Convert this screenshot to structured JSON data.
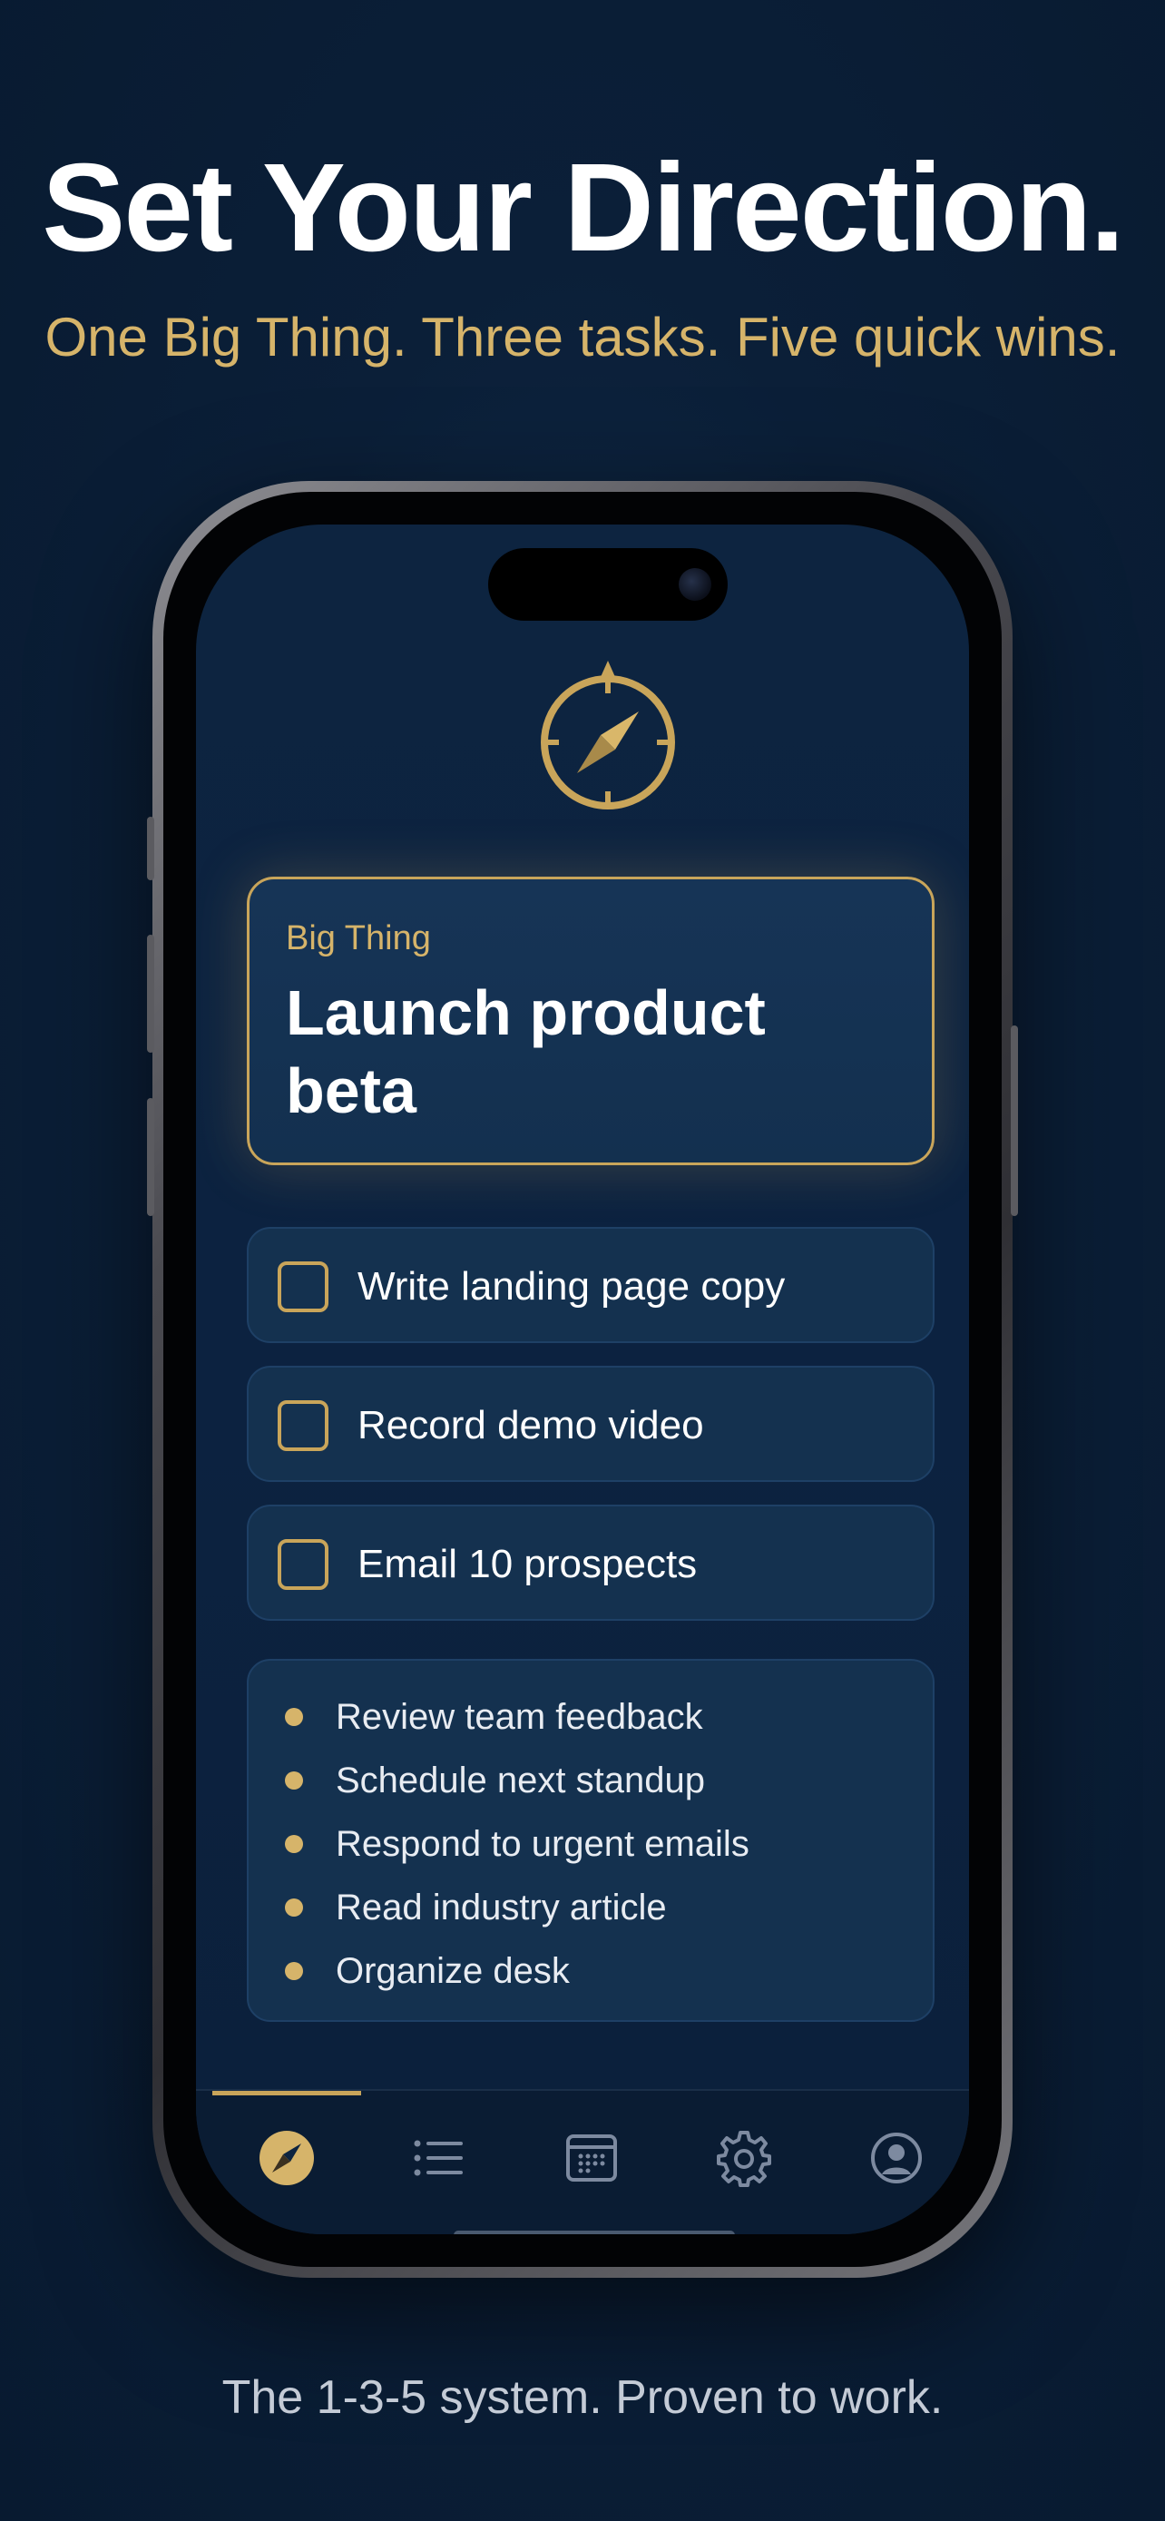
{
  "headline": "Set Your Direction.",
  "subheadline": "One Big Thing. Three tasks. Five quick wins.",
  "tagline": "The 1-3-5 system. Proven to work.",
  "app": {
    "logo_icon": "compass-icon",
    "big_thing": {
      "label": "Big Thing",
      "title": "Launch product beta"
    },
    "tasks": [
      {
        "label": "Write landing page copy",
        "checked": false
      },
      {
        "label": "Record demo video",
        "checked": false
      },
      {
        "label": "Email 10 prospects",
        "checked": false
      }
    ],
    "quick_wins": [
      "Review team feedback",
      "Schedule next standup",
      "Respond to urgent emails",
      "Read industry article",
      "Organize desk"
    ],
    "tabbar": {
      "tabs": [
        {
          "icon": "compass-icon",
          "active": true
        },
        {
          "icon": "list-icon",
          "active": false
        },
        {
          "icon": "calendar-icon",
          "active": false
        },
        {
          "icon": "gear-icon",
          "active": false
        },
        {
          "icon": "profile-icon",
          "active": false
        }
      ]
    }
  },
  "colors": {
    "background": "#0b1f38",
    "accent_gold": "#d6b46a",
    "card": "#14314f",
    "text": "#ffffff"
  }
}
